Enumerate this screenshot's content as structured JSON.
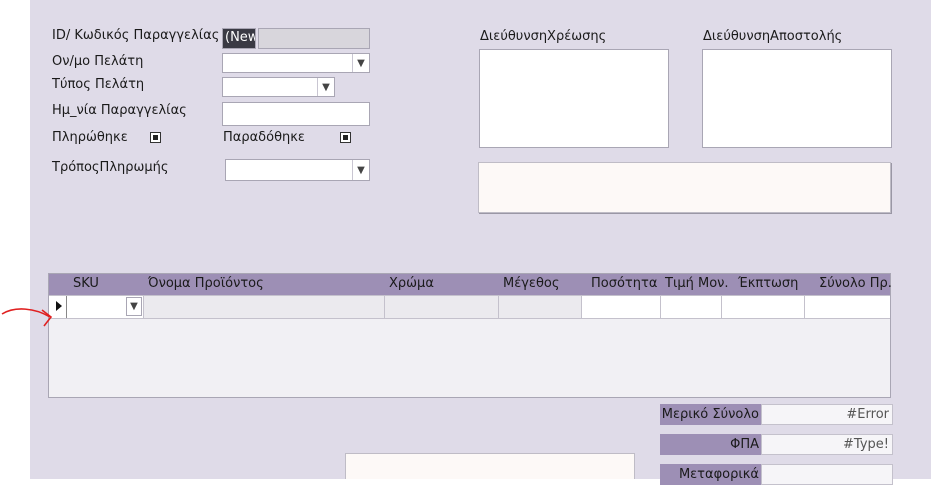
{
  "form": {
    "order_id_label": "ID/ Κωδικός Παραγγελίας",
    "order_id_value": "(New)",
    "customer_name_label": "Ον/μο Πελάτη",
    "customer_type_label": "Τύπος Πελάτη",
    "order_date_label": "Ημ_νία Παραγγελίας",
    "paid_label": "Πληρώθηκε",
    "delivered_label": "Παραδόθηκε",
    "payment_method_label": "ΤρόποςΠληρωμής",
    "billing_address_label": "ΔιεύθυνσηΧρέωσης",
    "shipping_address_label": "ΔιεύθυνσηΑποστολής"
  },
  "subform": {
    "columns": [
      "SKU",
      "Όνομα Προϊόντος",
      "Χρώμα",
      "Μέγεθος",
      "Ποσότητα",
      "Τιμή Μον.",
      "Έκπτωση",
      "Σύνολο Πρ."
    ]
  },
  "totals": {
    "subtotal_label": "Μερικό Σύνολο",
    "subtotal_value": "#Error",
    "vat_label": "ΦΠΑ",
    "vat_value": "#Type!",
    "shipping_label": "Μεταφορικά",
    "shipping_value": ""
  },
  "colors": {
    "form_background": "#dfdbe8",
    "header_purple": "#9d8fb5",
    "annotation_red": "#e02020"
  },
  "icons": {
    "record_selector": "triangle-right",
    "combo_arrow": "chevron-down",
    "checkbox": "checked-square"
  }
}
